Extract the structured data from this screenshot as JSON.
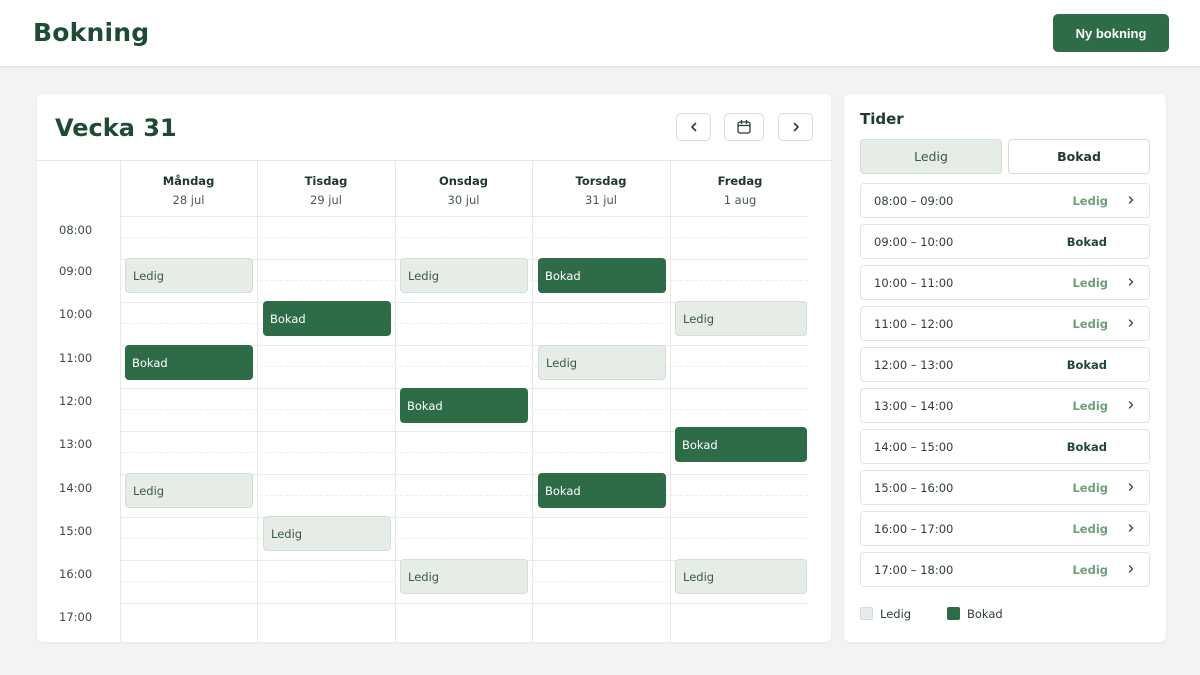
{
  "header": {
    "title": "Bokning",
    "new_button": "Ny bokning"
  },
  "calendar": {
    "week_title": "Vecka 31",
    "days": [
      {
        "name": "Måndag",
        "date": "28 jul"
      },
      {
        "name": "Tisdag",
        "date": "29 jul"
      },
      {
        "name": "Onsdag",
        "date": "30 jul"
      },
      {
        "name": "Torsdag",
        "date": "31 jul"
      },
      {
        "name": "Fredag",
        "date": "1 aug"
      }
    ],
    "times": [
      "08:00",
      "09:00",
      "10:00",
      "11:00",
      "12:00",
      "13:00",
      "14:00",
      "15:00",
      "16:00",
      "17:00"
    ],
    "slots": [
      {
        "day": 0,
        "label": "Ledig",
        "status": "free"
      },
      {
        "day": 0,
        "label": "Bokad",
        "status": "booked"
      },
      {
        "day": 0,
        "label": "Ledig",
        "status": "free"
      },
      {
        "day": 1,
        "label": "Bokad",
        "status": "booked"
      },
      {
        "day": 1,
        "label": "Ledig",
        "status": "free"
      },
      {
        "day": 2,
        "label": "Ledig",
        "status": "free"
      },
      {
        "day": 2,
        "label": "Bokad",
        "status": "booked"
      },
      {
        "day": 2,
        "label": "Ledig",
        "status": "free"
      },
      {
        "day": 3,
        "label": "Bokad",
        "status": "booked"
      },
      {
        "day": 3,
        "label": "Ledig",
        "status": "free"
      },
      {
        "day": 3,
        "label": "Bokad",
        "status": "booked"
      },
      {
        "day": 4,
        "label": "Ledig",
        "status": "free"
      },
      {
        "day": 4,
        "label": "Bokad",
        "status": "booked"
      },
      {
        "day": 4,
        "label": "Ledig",
        "status": "free"
      }
    ]
  },
  "sidebar": {
    "title": "Tider",
    "tabs": [
      {
        "label": "Ledig",
        "active": true
      },
      {
        "label": "Bokad",
        "active": false
      }
    ],
    "rows": [
      {
        "time": "08:00 – 09:00",
        "status": "Ledig",
        "type": "free"
      },
      {
        "time": "09:00 – 10:00",
        "status": "Bokad",
        "type": "booked"
      },
      {
        "time": "10:00 – 11:00",
        "status": "Ledig",
        "type": "free"
      },
      {
        "time": "11:00 – 12:00",
        "status": "Ledig",
        "type": "free"
      },
      {
        "time": "12:00 – 13:00",
        "status": "Bokad",
        "type": "booked"
      },
      {
        "time": "13:00 – 14:00",
        "status": "Ledig",
        "type": "free"
      },
      {
        "time": "14:00 – 15:00",
        "status": "Bokad",
        "type": "booked"
      },
      {
        "time": "15:00 – 16:00",
        "status": "Ledig",
        "type": "free"
      },
      {
        "time": "16:00 – 17:00",
        "status": "Ledig",
        "type": "free"
      },
      {
        "time": "17:00 – 18:00",
        "status": "Ledig",
        "type": "free"
      }
    ],
    "legend": [
      {
        "label": "Ledig",
        "color": "#e5ede6"
      },
      {
        "label": "Bokad",
        "color": "#2e6b47"
      }
    ]
  },
  "icons": {
    "prev": "chevron-left-icon",
    "calendar": "calendar-icon",
    "next": "chevron-right-icon",
    "row": "chevron-right-icon"
  },
  "colors": {
    "primary": "#2e6b47",
    "free": "#e5ede6",
    "free_text": "#6f9e78"
  }
}
